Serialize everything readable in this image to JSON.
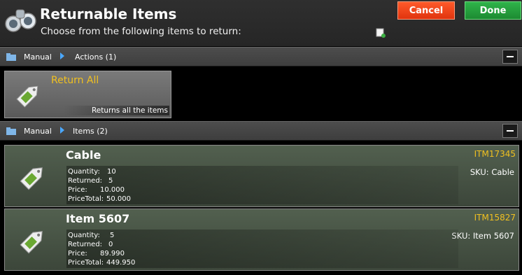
{
  "header": {
    "title": "Returnable Items",
    "subtitle": "Choose from the following items to return:",
    "cancel_label": "Cancel",
    "done_label": "Done"
  },
  "actions_section": {
    "breadcrumb_root": "Manual",
    "breadcrumb_leaf": "Actions (1)",
    "actions": [
      {
        "name": "Return All",
        "description": "Returns all the items"
      }
    ]
  },
  "items_section": {
    "breadcrumb_root": "Manual",
    "breadcrumb_leaf": "Items (2)",
    "items": [
      {
        "name": "Cable",
        "code": "ITM17345",
        "sku": "SKU: Cable",
        "quantity_label": "Quantity:",
        "quantity": "10",
        "returned_label": "Returned:",
        "returned": "5",
        "price_label": "Price:",
        "price": "10.000",
        "pricetotal_label": "PriceTotal:",
        "pricetotal": "50.000"
      },
      {
        "name": "Item 5607",
        "code": "ITM15827",
        "sku": "SKU: Item 5607",
        "quantity_label": "Quantity:",
        "quantity": "5",
        "returned_label": "Returned:",
        "returned": "0",
        "price_label": "Price:",
        "price": "89.990",
        "pricetotal_label": "PriceTotal:",
        "pricetotal": "449.950"
      }
    ]
  },
  "colors": {
    "cancel": "#e8401a",
    "done": "#24a03c",
    "accent_yellow": "#f0c020",
    "arrow_blue": "#4aa8ff"
  }
}
